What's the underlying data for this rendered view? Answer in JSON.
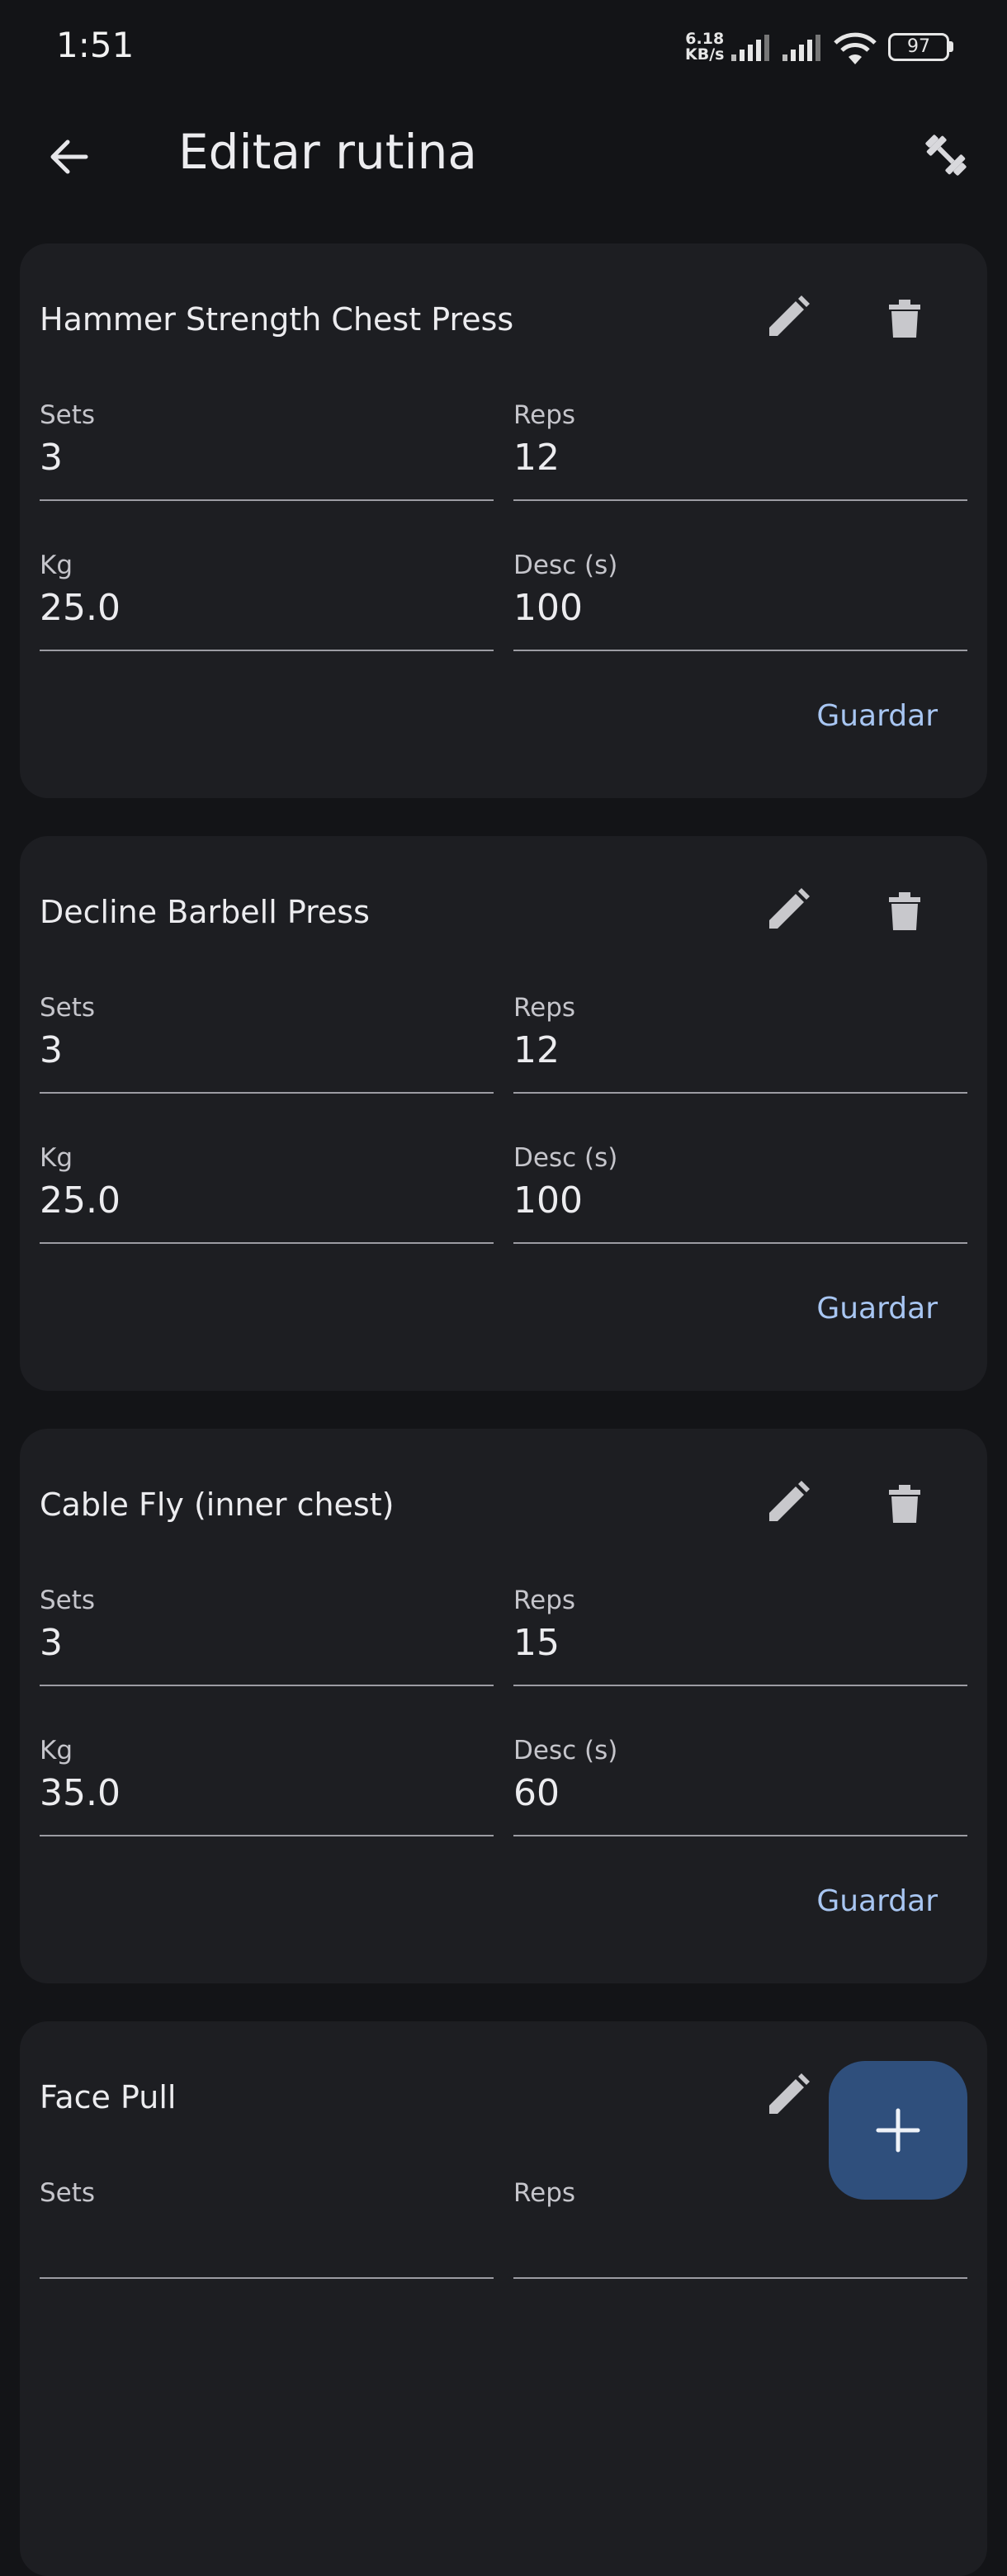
{
  "status_bar": {
    "time": "1:51",
    "net_speed_value": "6.18",
    "net_speed_unit": "KB/s",
    "battery": "97"
  },
  "app_bar": {
    "title": "Editar rutina",
    "back_icon": "arrow-left-icon",
    "action_icon": "dumbbell-icon"
  },
  "colors": {
    "background": "#131417",
    "card": "#1d1e22",
    "accent": "#a8c6f2",
    "fab": "#2f4f7c"
  },
  "exercises": [
    {
      "name": "Hammer Strength Chest Press",
      "sets_label": "Sets",
      "sets": "3",
      "reps_label": "Reps",
      "reps": "12",
      "kg_label": "Kg",
      "kg": "25.0",
      "rest_label": "Desc (s)",
      "rest": "100",
      "save_label": "Guardar"
    },
    {
      "name": "Decline Barbell Press",
      "sets_label": "Sets",
      "sets": "3",
      "reps_label": "Reps",
      "reps": "12",
      "kg_label": "Kg",
      "kg": "25.0",
      "rest_label": "Desc (s)",
      "rest": "100",
      "save_label": "Guardar"
    },
    {
      "name": "Cable Fly (inner chest)",
      "sets_label": "Sets",
      "sets": "3",
      "reps_label": "Reps",
      "reps": "15",
      "kg_label": "Kg",
      "kg": "35.0",
      "rest_label": "Desc (s)",
      "rest": "60",
      "save_label": "Guardar"
    },
    {
      "name": "Face Pull",
      "sets_label": "Sets",
      "sets": "",
      "reps_label": "Reps",
      "reps": "",
      "kg_label": "",
      "kg": "",
      "rest_label": "",
      "rest": "",
      "save_label": ""
    }
  ],
  "fab": {
    "icon": "plus-icon"
  }
}
